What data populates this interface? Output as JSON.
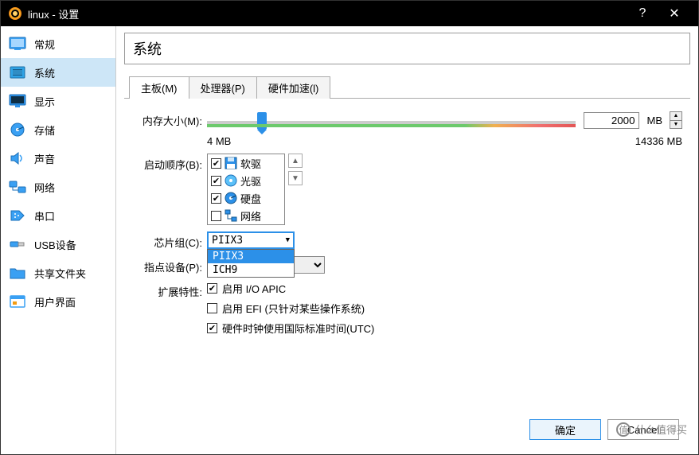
{
  "window": {
    "title": "linux - 设置"
  },
  "sidebar": [
    {
      "key": "general",
      "label": "常规"
    },
    {
      "key": "system",
      "label": "系统"
    },
    {
      "key": "display",
      "label": "显示"
    },
    {
      "key": "storage",
      "label": "存储"
    },
    {
      "key": "audio",
      "label": "声音"
    },
    {
      "key": "network",
      "label": "网络"
    },
    {
      "key": "serial",
      "label": "串口"
    },
    {
      "key": "usb",
      "label": "USB设备"
    },
    {
      "key": "shared",
      "label": "共享文件夹"
    },
    {
      "key": "ui",
      "label": "用户界面"
    }
  ],
  "page": {
    "title": "系统"
  },
  "tabs": [
    {
      "label": "主板(M)"
    },
    {
      "label": "处理器(P)"
    },
    {
      "label": "硬件加速(l)"
    }
  ],
  "labels": {
    "memory": "内存大小(M):",
    "boot": "启动顺序(B):",
    "chipset": "芯片组(C):",
    "pointing": "指点设备(P):",
    "ext": "扩展特性:",
    "mem_min": "4 MB",
    "mem_max": "14336 MB",
    "unit": "MB"
  },
  "memory": {
    "value": "2000"
  },
  "boot": [
    {
      "checked": true,
      "icon": "floppy",
      "label": "软驱"
    },
    {
      "checked": true,
      "icon": "optical",
      "label": "光驱"
    },
    {
      "checked": true,
      "icon": "disk",
      "label": "硬盘"
    },
    {
      "checked": false,
      "icon": "net",
      "label": "网络"
    }
  ],
  "chipset": {
    "value": "PIIX3",
    "options": [
      "PIIX3",
      "ICH9"
    ]
  },
  "pointing": {
    "value": ""
  },
  "ext": [
    {
      "checked": true,
      "label": "启用 I/O APIC"
    },
    {
      "checked": false,
      "label": "启用 EFI (只针对某些操作系统)"
    },
    {
      "checked": true,
      "label": "硬件时钟使用国际标准时间(UTC)"
    }
  ],
  "footer": {
    "ok": "确定",
    "cancel": "Cancel"
  },
  "watermark": "什么值得买"
}
